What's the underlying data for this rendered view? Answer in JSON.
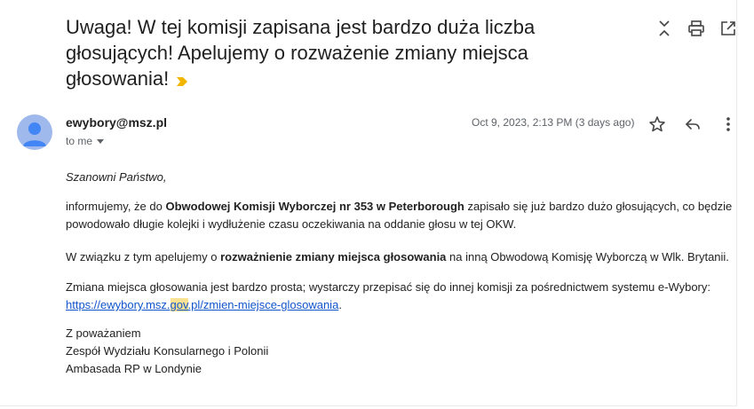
{
  "email": {
    "subject": "Uwaga! W tej komisji zapisana jest bardzo duża liczba głosujących! Apelujemy o rozważenie zmiany miejsca głosowania!",
    "sender": "ewybory@msz.pl",
    "recipient_label": "to me",
    "date": "Oct 9, 2023, 2:13 PM (3 days ago)",
    "body": {
      "greeting": "Szanowni Państwo,",
      "p1_a": "informujemy, że do ",
      "p1_b": "Obwodowej Komisji Wyborczej nr 353 w Peterborough",
      "p1_c": " zapisało się już bardzo dużo głosujących, co będzie powodowało długie kolejki i wydłużenie czasu oczekiwania na oddanie głosu w tej OKW.",
      "p2_a": "W związku z tym apelujemy o ",
      "p2_b": "rozważnienie zmiany miejsca głosowania",
      "p2_c": " na inną Obwodową Komisję Wyborczą w Wlk. Brytanii.",
      "p3_a": "Zmiana miejsca głosowania jest bardzo prosta; wystarczy przepisać się do innej komisji za pośrednictwem systemu e-Wybory:",
      "link_a": "https://ewybory.msz.",
      "link_b": "gov",
      "link_c": ".pl/zmien-miejsce-glosowania",
      "link_end": ".",
      "sig1": "Z poważaniem",
      "sig2": "Zespół Wydziału Konsularnego i Polonii",
      "sig3": "Ambasada RP w Londynie"
    }
  },
  "icons": {
    "toolbar": [
      "expand-collapse-icon",
      "print-icon",
      "open-new-window-icon"
    ],
    "header": [
      "star-icon",
      "reply-icon",
      "more-options-icon"
    ],
    "importance": "important-marker-icon",
    "avatar": "default-avatar-icon"
  },
  "colors": {
    "link": "#1155cc",
    "highlight": "#fde293",
    "importance_marker": "#f2b600",
    "avatar_bg": "#9fb9ec",
    "avatar_fg": "#4285f4"
  }
}
